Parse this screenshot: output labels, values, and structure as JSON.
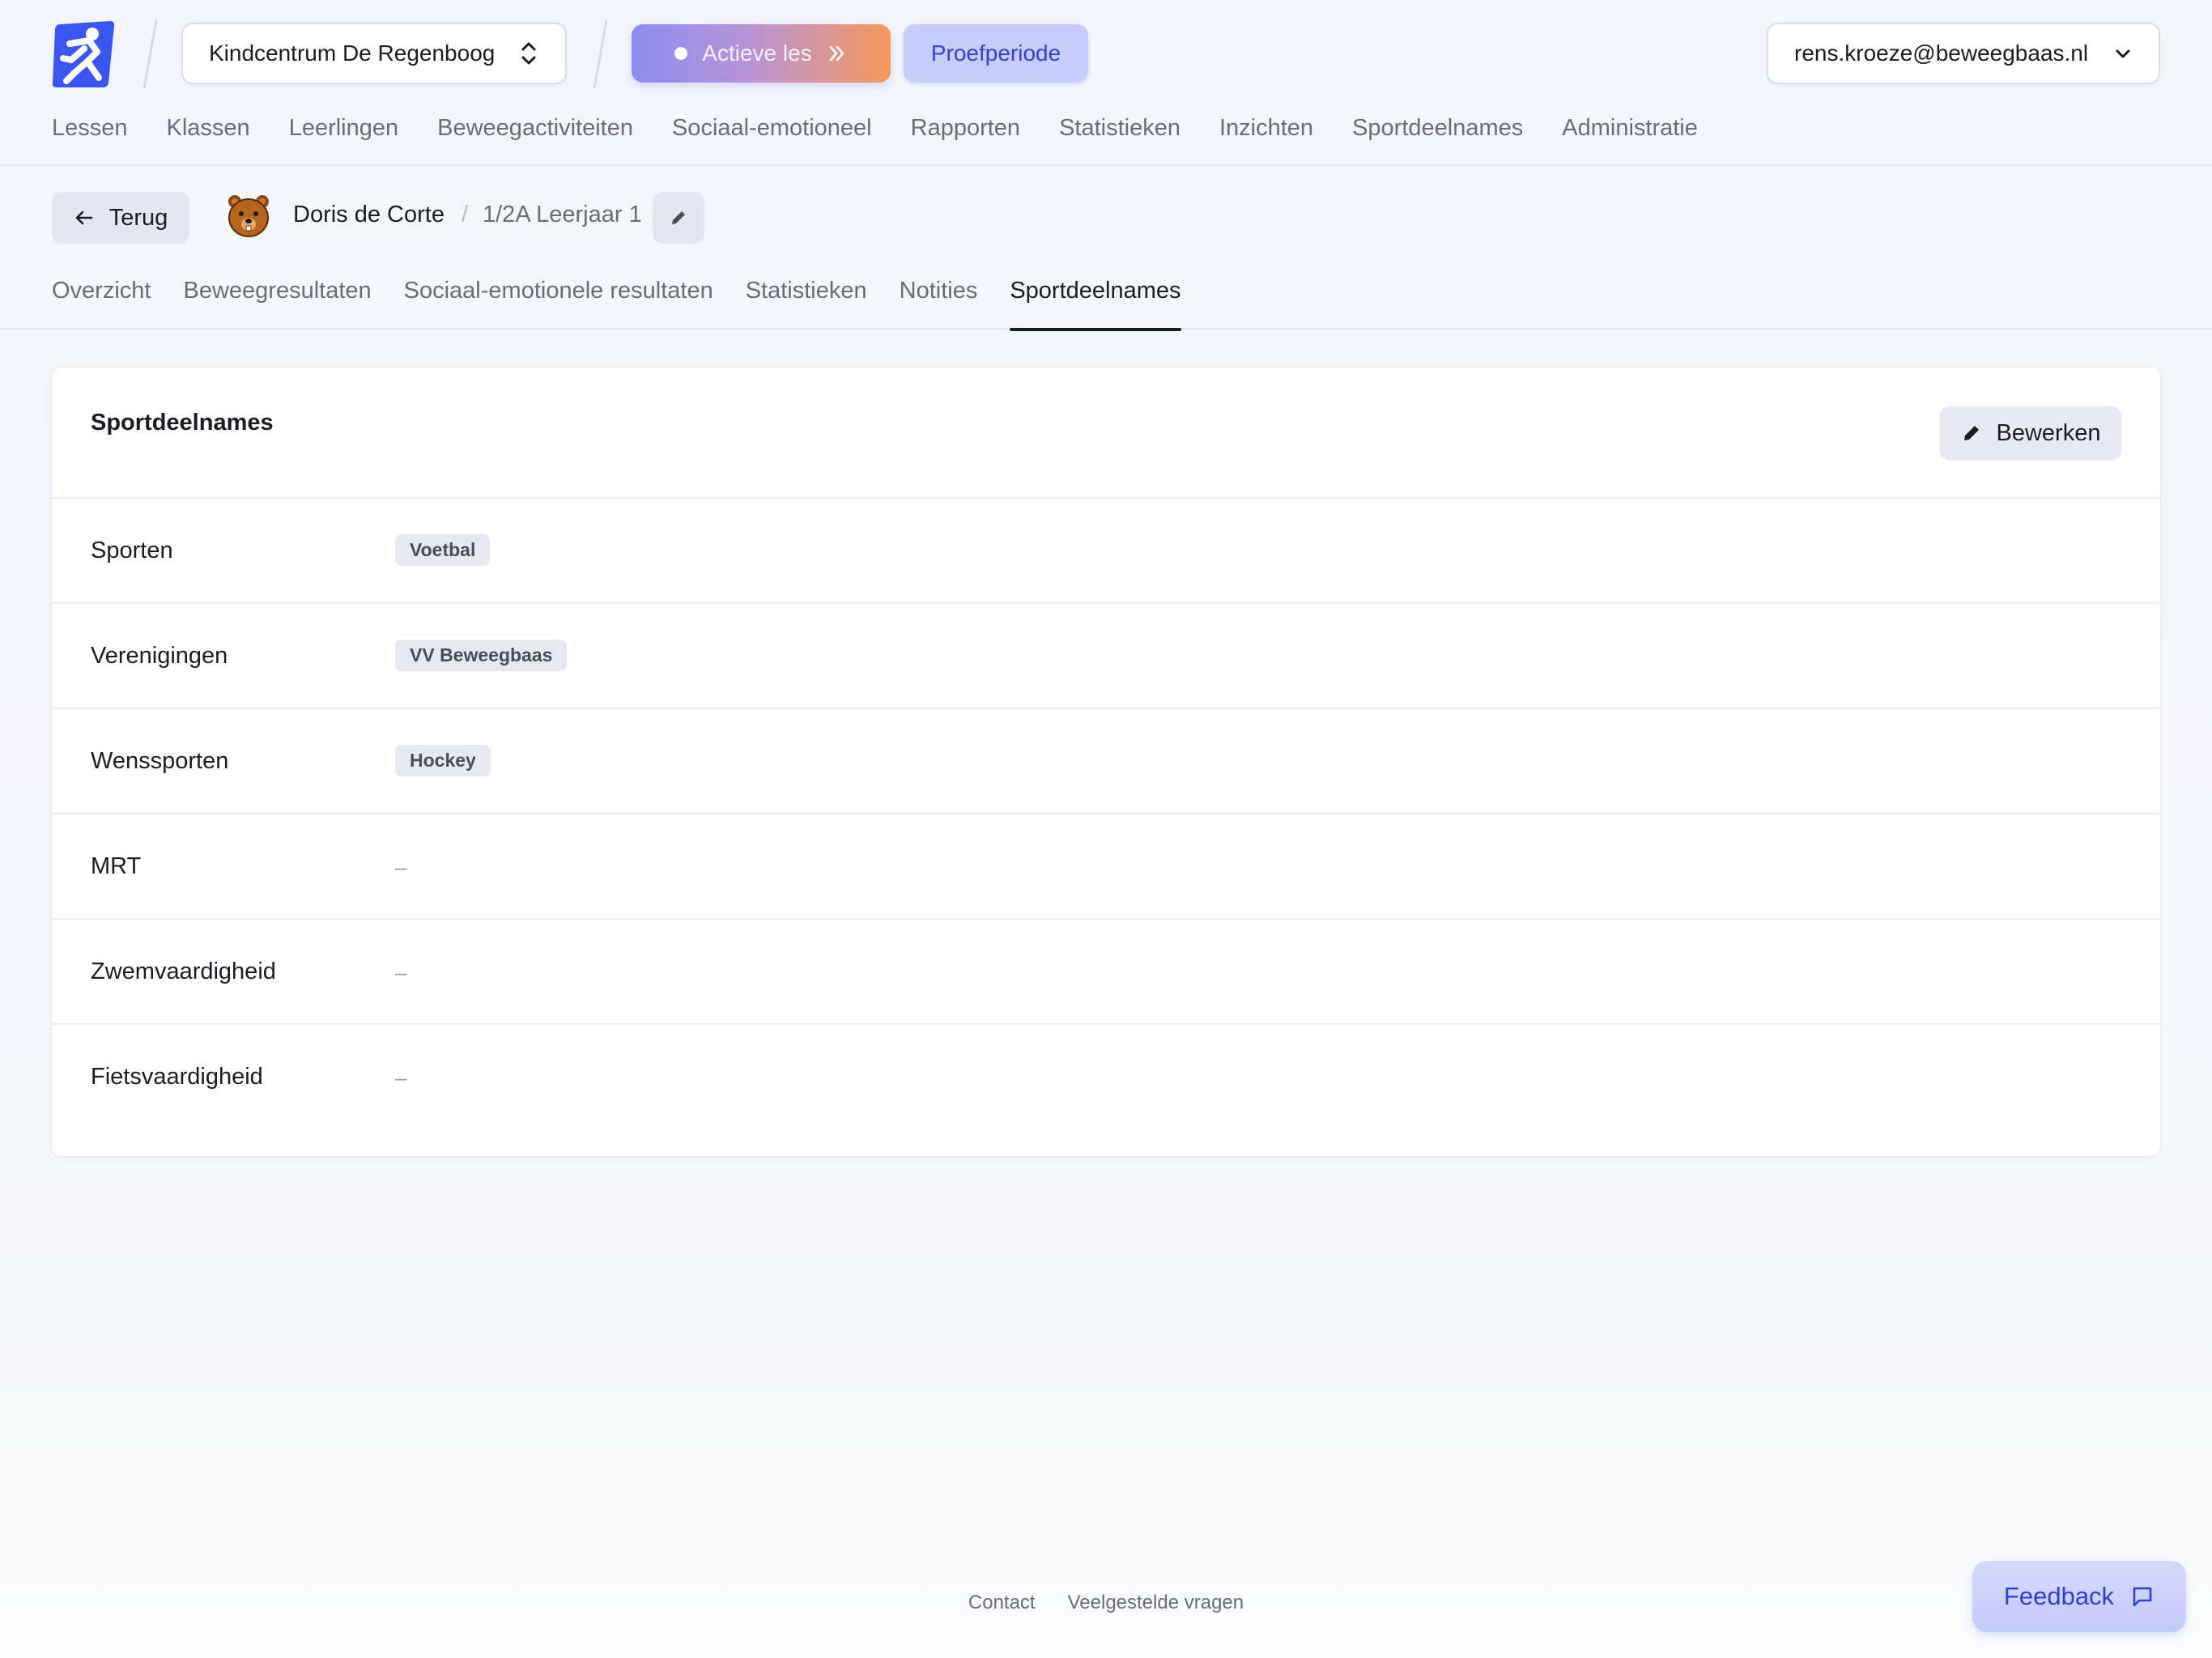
{
  "header": {
    "school": "Kindcentrum De Regenboog",
    "active_lesson": "Actieve les",
    "trial": "Proefperiode",
    "user": "rens.kroeze@beweegbaas.nl",
    "nav": [
      "Lessen",
      "Klassen",
      "Leerlingen",
      "Beweegactiviteiten",
      "Sociaal-emotioneel",
      "Rapporten",
      "Statistieken",
      "Inzichten",
      "Sportdeelnames",
      "Administratie"
    ]
  },
  "student": {
    "back_label": "Terug",
    "name": "Doris de Corte",
    "separator": "/",
    "class": "1/2A Leerjaar 1",
    "tabs": [
      "Overzicht",
      "Beweegresultaten",
      "Sociaal-emotionele resultaten",
      "Statistieken",
      "Notities",
      "Sportdeelnames"
    ],
    "active_tab": "Sportdeelnames"
  },
  "card": {
    "title": "Sportdeelnames",
    "edit_label": "Bewerken",
    "rows": [
      {
        "label": "Sporten",
        "badges": [
          "Voetbal"
        ]
      },
      {
        "label": "Verenigingen",
        "badges": [
          "VV Beweegbaas"
        ]
      },
      {
        "label": "Wenssporten",
        "badges": [
          "Hockey"
        ]
      },
      {
        "label": "MRT",
        "empty": "–"
      },
      {
        "label": "Zwemvaardigheid",
        "empty": "–"
      },
      {
        "label": "Fietsvaardigheid",
        "empty": "–"
      }
    ]
  },
  "footer": {
    "contact": "Contact",
    "faq": "Veelgestelde vragen",
    "feedback": "Feedback"
  },
  "colors": {
    "brand": "#3b56f0",
    "trial_text": "#3344cc",
    "active_gradient_start": "#8c8ff0",
    "active_gradient_end": "#f6985c"
  }
}
